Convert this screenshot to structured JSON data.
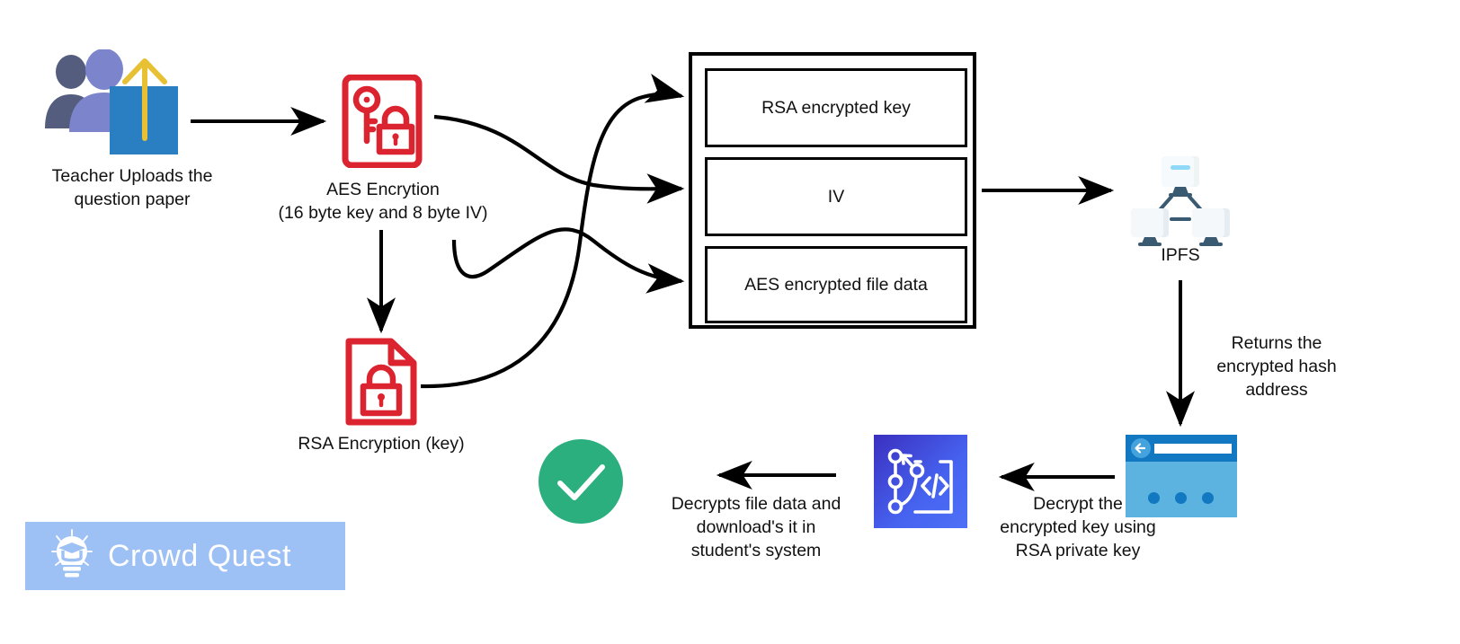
{
  "diagram": {
    "title_present": false,
    "nodes": {
      "teacher": {
        "icon": "people-upload-icon",
        "caption": "Teacher Uploads the\nquestion paper"
      },
      "aes": {
        "icon": "key-lock-document-icon",
        "caption": "AES Encrytion\n(16 byte key and 8 byte IV)"
      },
      "rsa": {
        "icon": "locked-document-icon",
        "caption": "RSA Encryption (key)"
      },
      "store": {
        "items": [
          "RSA encrypted key",
          "IV",
          "AES encrypted file\ndata"
        ]
      },
      "ipfs": {
        "icon": "network-computers-icon",
        "caption": "IPFS"
      },
      "returns": {
        "caption": "Returns the\nencrypted hash\naddress"
      },
      "browser": {
        "icon": "browser-window-icon",
        "caption": ""
      },
      "decrypt_key": {
        "icon": "code-branch-icon",
        "caption": "Decrypt the\nencrypted key using\nRSA private key"
      },
      "decrypt_file": {
        "caption": "Decrypts file data and\ndownload's it in\nstudent's system"
      },
      "success": {
        "icon": "check-circle-icon"
      }
    },
    "logo": {
      "icon": "lightbulb-graduation-cap-icon",
      "text": "Crowd Quest"
    },
    "colors": {
      "accent_red": "#DC2430",
      "accent_blue": "#2A7FC3",
      "person_dark": "#545D7E",
      "person_light": "#7C85CC",
      "arrow_yellow": "#E8C033",
      "success_green": "#2CAF7E",
      "logo_banner": "#9DC0F5",
      "code_tile": "#4663F0",
      "browser_blue": "#5CB3E0",
      "stroke_black": "#000000"
    }
  }
}
